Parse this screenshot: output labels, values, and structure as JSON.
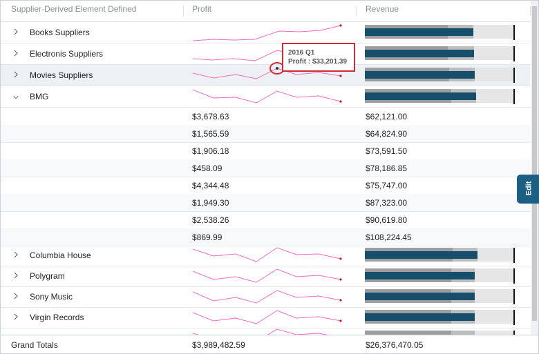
{
  "columns": {
    "element": "Supplier-Derived Element Defined",
    "profit": "Profit",
    "revenue": "Revenue"
  },
  "rows": [
    {
      "name": "Books Suppliers",
      "expanded": false
    },
    {
      "name": "Electronis Suppliers",
      "expanded": false
    },
    {
      "name": "Movies Suppliers",
      "expanded": false,
      "highlighted": true
    },
    {
      "name": "BMG",
      "expanded": true
    }
  ],
  "bmg_details": [
    {
      "profit": "$3,678.63",
      "revenue": "$62,121.00"
    },
    {
      "profit": "$1,565.59",
      "revenue": "$64,824.90"
    },
    {
      "profit": "$1,906.18",
      "revenue": "$73,591.50"
    },
    {
      "profit": "$458.09",
      "revenue": "$78,186.85"
    },
    {
      "profit": "$4,344.48",
      "revenue": "$75,747.00"
    },
    {
      "profit": "$1,949.30",
      "revenue": "$87,323.00"
    },
    {
      "profit": "$2,538.26",
      "revenue": "$90,619.80"
    },
    {
      "profit": "$869.99",
      "revenue": "$108,224.45"
    }
  ],
  "rows_after": [
    {
      "name": "Columbia House",
      "expanded": false
    },
    {
      "name": "Polygram",
      "expanded": false
    },
    {
      "name": "Sony Music",
      "expanded": false
    },
    {
      "name": "Virgin Records",
      "expanded": false
    }
  ],
  "tooltip": {
    "period": "2016 Q1",
    "profit": "Profit : $33,201.39"
  },
  "edit_tab": "Edit",
  "totals": {
    "label": "Grand Totals",
    "profit": "$3,989,482.59",
    "revenue": "$26,376,470.05"
  },
  "colors": {
    "sparkline": "#f26bbd",
    "sparkline_end": "#d0142c",
    "revenue_bar": "#174e6b",
    "highlight": "#d32b34",
    "edit_tab": "#1c5f85"
  }
}
